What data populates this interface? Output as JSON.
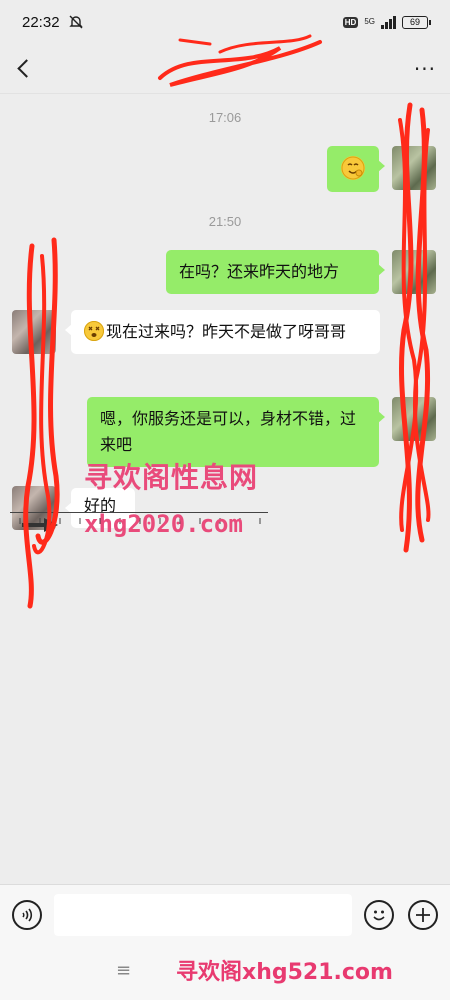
{
  "status_bar": {
    "time": "22:32",
    "network_label": "5G",
    "hd_label": "HD",
    "battery_level": "69",
    "icons": [
      "mute-icon",
      "hd-icon",
      "signal-icon",
      "battery-icon"
    ]
  },
  "header": {
    "title": "",
    "more_label": "···"
  },
  "messages": [
    {
      "type": "timestamp",
      "text": "17:06"
    },
    {
      "type": "outgoing",
      "content": "emoji",
      "emoji": "yellow-face-emoji"
    },
    {
      "type": "timestamp",
      "text": "21:50"
    },
    {
      "type": "outgoing",
      "text": "在吗？还来昨天的地方"
    },
    {
      "type": "incoming",
      "emoji": "dizzy-face-emoji",
      "text": "现在过来吗？昨天不是做了呀哥哥"
    },
    {
      "type": "outgoing",
      "text": "嗯，你服务还是可以，身材不错，过来吧"
    },
    {
      "type": "incoming",
      "text": "好的"
    }
  ],
  "watermark": {
    "site_name": "寻欢阁性息网",
    "site_url": "xhg2020.com",
    "footer_text": "寻欢阁xhg521.com",
    "color": "#e94b7b"
  },
  "input_bar": {
    "placeholder": "",
    "icons": [
      "voice-icon",
      "emoji-icon",
      "plus-icon"
    ]
  },
  "nav_bar": {
    "menu_label": "≡"
  },
  "colors": {
    "outgoing_bubble": "#95ec69",
    "incoming_bubble": "#ffffff",
    "background": "#ededed",
    "redaction": "#ff2a1a"
  }
}
